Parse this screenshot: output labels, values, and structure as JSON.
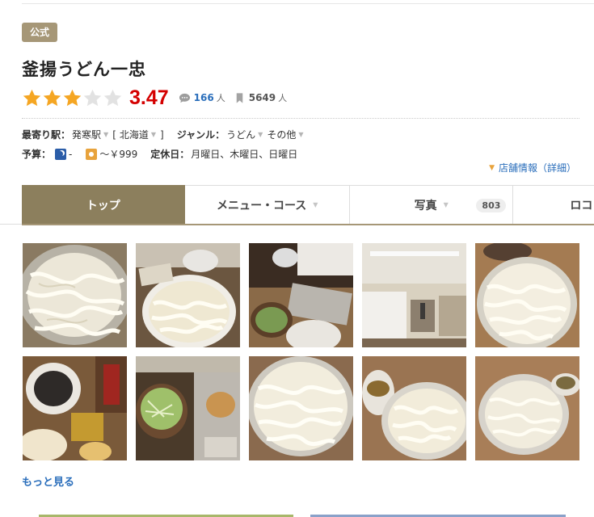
{
  "badge": "公式",
  "restaurant": {
    "name": "釜揚うどん一忠"
  },
  "rating": {
    "score": "3.47",
    "stars_value": 3.47,
    "stars_max": 5,
    "reviews_count": "166",
    "reviews_unit": "人",
    "saves_count": "5649",
    "saves_unit": "人"
  },
  "info": {
    "station_label": "最寄り駅：",
    "station": "発寒駅",
    "area_bracket_open": "[",
    "area": "北海道",
    "area_bracket_close": "]",
    "genre_label": "ジャンル：",
    "genre1": "うどん",
    "genre2": "その他",
    "budget_label": "予算：",
    "budget_dinner": "-",
    "budget_lunch": "～￥999",
    "holiday_label": "定休日：",
    "holiday": "月曜日、木曜日、日曜日",
    "detail_link": "店舗情報（詳細）"
  },
  "tabs": [
    {
      "label": "トップ"
    },
    {
      "label": "メニュー・コース"
    },
    {
      "label": "写真",
      "count": "803"
    },
    {
      "label": "ロコミ"
    }
  ],
  "more_link": "もっと見る",
  "colors": {
    "accent": "#8c7f5d",
    "score": "#d40000",
    "link": "#2a6ebb",
    "star": "#f5a623"
  },
  "icons": [
    "star-icon",
    "speech-bubble-icon",
    "bookmark-icon",
    "moon-icon",
    "sun-icon",
    "chevron-down-icon"
  ]
}
